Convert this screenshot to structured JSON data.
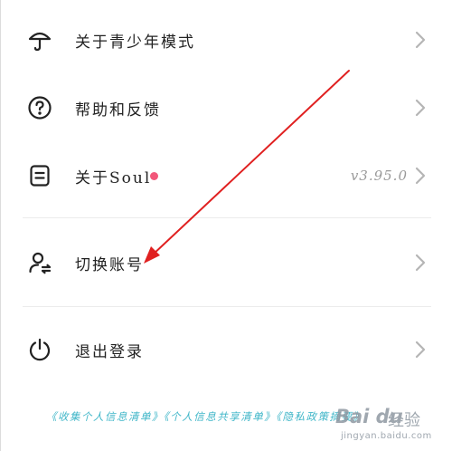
{
  "menu": {
    "items": [
      {
        "label": "关于青少年模式",
        "icon": "umbrella-icon"
      },
      {
        "label": "帮助和反馈",
        "icon": "question-circle-icon"
      },
      {
        "label": "关于Soul",
        "icon": "document-icon",
        "badge_color": "#f2577a",
        "version": "v3.95.0"
      },
      {
        "label": "切换账号",
        "icon": "switch-account-icon"
      },
      {
        "label": "退出登录",
        "icon": "power-icon"
      }
    ]
  },
  "footer": {
    "links_text": "《收集个人信息清单》《个人信息共享清单》《隐私政策摘要》"
  },
  "watermark": {
    "logo": "Bai du",
    "logo_cn": "经验",
    "url": "jingyan.baidu.com"
  },
  "colors": {
    "accent": "#f2577a",
    "link": "#3fb6c8",
    "annotation_arrow": "#e02020"
  }
}
